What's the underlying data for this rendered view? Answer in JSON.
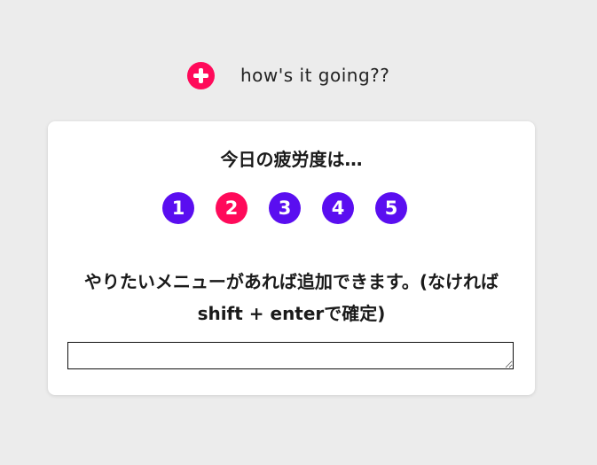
{
  "header": {
    "add_icon": "plus-circle-icon",
    "greeting": "how's it going??"
  },
  "card": {
    "question": "今日の疲労度は…",
    "ratings": [
      "1",
      "2",
      "3",
      "4",
      "5"
    ],
    "selected_rating": "2",
    "menu_prompt": "やりたいメニューがあれば追加できます。(なければshift + enterで確定)",
    "menu_input_value": "",
    "menu_input_placeholder": ""
  },
  "colors": {
    "background": "#ececec",
    "accent_pink": "#ff0a5a",
    "accent_purple": "#5a0ef0",
    "card": "#ffffff"
  }
}
